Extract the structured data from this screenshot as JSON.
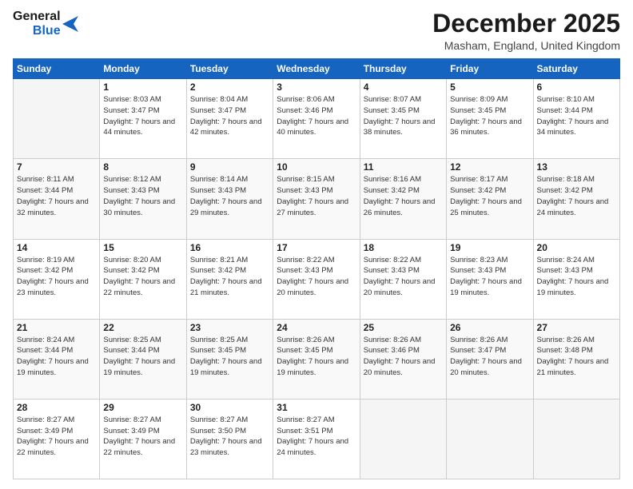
{
  "logo": {
    "part1": "General",
    "part2": "Blue"
  },
  "title": "December 2025",
  "location": "Masham, England, United Kingdom",
  "days_header": [
    "Sunday",
    "Monday",
    "Tuesday",
    "Wednesday",
    "Thursday",
    "Friday",
    "Saturday"
  ],
  "weeks": [
    [
      {
        "day": "",
        "sunrise": "",
        "sunset": "",
        "daylight": ""
      },
      {
        "day": "1",
        "sunrise": "Sunrise: 8:03 AM",
        "sunset": "Sunset: 3:47 PM",
        "daylight": "Daylight: 7 hours and 44 minutes."
      },
      {
        "day": "2",
        "sunrise": "Sunrise: 8:04 AM",
        "sunset": "Sunset: 3:47 PM",
        "daylight": "Daylight: 7 hours and 42 minutes."
      },
      {
        "day": "3",
        "sunrise": "Sunrise: 8:06 AM",
        "sunset": "Sunset: 3:46 PM",
        "daylight": "Daylight: 7 hours and 40 minutes."
      },
      {
        "day": "4",
        "sunrise": "Sunrise: 8:07 AM",
        "sunset": "Sunset: 3:45 PM",
        "daylight": "Daylight: 7 hours and 38 minutes."
      },
      {
        "day": "5",
        "sunrise": "Sunrise: 8:09 AM",
        "sunset": "Sunset: 3:45 PM",
        "daylight": "Daylight: 7 hours and 36 minutes."
      },
      {
        "day": "6",
        "sunrise": "Sunrise: 8:10 AM",
        "sunset": "Sunset: 3:44 PM",
        "daylight": "Daylight: 7 hours and 34 minutes."
      }
    ],
    [
      {
        "day": "7",
        "sunrise": "Sunrise: 8:11 AM",
        "sunset": "Sunset: 3:44 PM",
        "daylight": "Daylight: 7 hours and 32 minutes."
      },
      {
        "day": "8",
        "sunrise": "Sunrise: 8:12 AM",
        "sunset": "Sunset: 3:43 PM",
        "daylight": "Daylight: 7 hours and 30 minutes."
      },
      {
        "day": "9",
        "sunrise": "Sunrise: 8:14 AM",
        "sunset": "Sunset: 3:43 PM",
        "daylight": "Daylight: 7 hours and 29 minutes."
      },
      {
        "day": "10",
        "sunrise": "Sunrise: 8:15 AM",
        "sunset": "Sunset: 3:43 PM",
        "daylight": "Daylight: 7 hours and 27 minutes."
      },
      {
        "day": "11",
        "sunrise": "Sunrise: 8:16 AM",
        "sunset": "Sunset: 3:42 PM",
        "daylight": "Daylight: 7 hours and 26 minutes."
      },
      {
        "day": "12",
        "sunrise": "Sunrise: 8:17 AM",
        "sunset": "Sunset: 3:42 PM",
        "daylight": "Daylight: 7 hours and 25 minutes."
      },
      {
        "day": "13",
        "sunrise": "Sunrise: 8:18 AM",
        "sunset": "Sunset: 3:42 PM",
        "daylight": "Daylight: 7 hours and 24 minutes."
      }
    ],
    [
      {
        "day": "14",
        "sunrise": "Sunrise: 8:19 AM",
        "sunset": "Sunset: 3:42 PM",
        "daylight": "Daylight: 7 hours and 23 minutes."
      },
      {
        "day": "15",
        "sunrise": "Sunrise: 8:20 AM",
        "sunset": "Sunset: 3:42 PM",
        "daylight": "Daylight: 7 hours and 22 minutes."
      },
      {
        "day": "16",
        "sunrise": "Sunrise: 8:21 AM",
        "sunset": "Sunset: 3:42 PM",
        "daylight": "Daylight: 7 hours and 21 minutes."
      },
      {
        "day": "17",
        "sunrise": "Sunrise: 8:22 AM",
        "sunset": "Sunset: 3:43 PM",
        "daylight": "Daylight: 7 hours and 20 minutes."
      },
      {
        "day": "18",
        "sunrise": "Sunrise: 8:22 AM",
        "sunset": "Sunset: 3:43 PM",
        "daylight": "Daylight: 7 hours and 20 minutes."
      },
      {
        "day": "19",
        "sunrise": "Sunrise: 8:23 AM",
        "sunset": "Sunset: 3:43 PM",
        "daylight": "Daylight: 7 hours and 19 minutes."
      },
      {
        "day": "20",
        "sunrise": "Sunrise: 8:24 AM",
        "sunset": "Sunset: 3:43 PM",
        "daylight": "Daylight: 7 hours and 19 minutes."
      }
    ],
    [
      {
        "day": "21",
        "sunrise": "Sunrise: 8:24 AM",
        "sunset": "Sunset: 3:44 PM",
        "daylight": "Daylight: 7 hours and 19 minutes."
      },
      {
        "day": "22",
        "sunrise": "Sunrise: 8:25 AM",
        "sunset": "Sunset: 3:44 PM",
        "daylight": "Daylight: 7 hours and 19 minutes."
      },
      {
        "day": "23",
        "sunrise": "Sunrise: 8:25 AM",
        "sunset": "Sunset: 3:45 PM",
        "daylight": "Daylight: 7 hours and 19 minutes."
      },
      {
        "day": "24",
        "sunrise": "Sunrise: 8:26 AM",
        "sunset": "Sunset: 3:45 PM",
        "daylight": "Daylight: 7 hours and 19 minutes."
      },
      {
        "day": "25",
        "sunrise": "Sunrise: 8:26 AM",
        "sunset": "Sunset: 3:46 PM",
        "daylight": "Daylight: 7 hours and 20 minutes."
      },
      {
        "day": "26",
        "sunrise": "Sunrise: 8:26 AM",
        "sunset": "Sunset: 3:47 PM",
        "daylight": "Daylight: 7 hours and 20 minutes."
      },
      {
        "day": "27",
        "sunrise": "Sunrise: 8:26 AM",
        "sunset": "Sunset: 3:48 PM",
        "daylight": "Daylight: 7 hours and 21 minutes."
      }
    ],
    [
      {
        "day": "28",
        "sunrise": "Sunrise: 8:27 AM",
        "sunset": "Sunset: 3:49 PM",
        "daylight": "Daylight: 7 hours and 22 minutes."
      },
      {
        "day": "29",
        "sunrise": "Sunrise: 8:27 AM",
        "sunset": "Sunset: 3:49 PM",
        "daylight": "Daylight: 7 hours and 22 minutes."
      },
      {
        "day": "30",
        "sunrise": "Sunrise: 8:27 AM",
        "sunset": "Sunset: 3:50 PM",
        "daylight": "Daylight: 7 hours and 23 minutes."
      },
      {
        "day": "31",
        "sunrise": "Sunrise: 8:27 AM",
        "sunset": "Sunset: 3:51 PM",
        "daylight": "Daylight: 7 hours and 24 minutes."
      },
      {
        "day": "",
        "sunrise": "",
        "sunset": "",
        "daylight": ""
      },
      {
        "day": "",
        "sunrise": "",
        "sunset": "",
        "daylight": ""
      },
      {
        "day": "",
        "sunrise": "",
        "sunset": "",
        "daylight": ""
      }
    ]
  ]
}
